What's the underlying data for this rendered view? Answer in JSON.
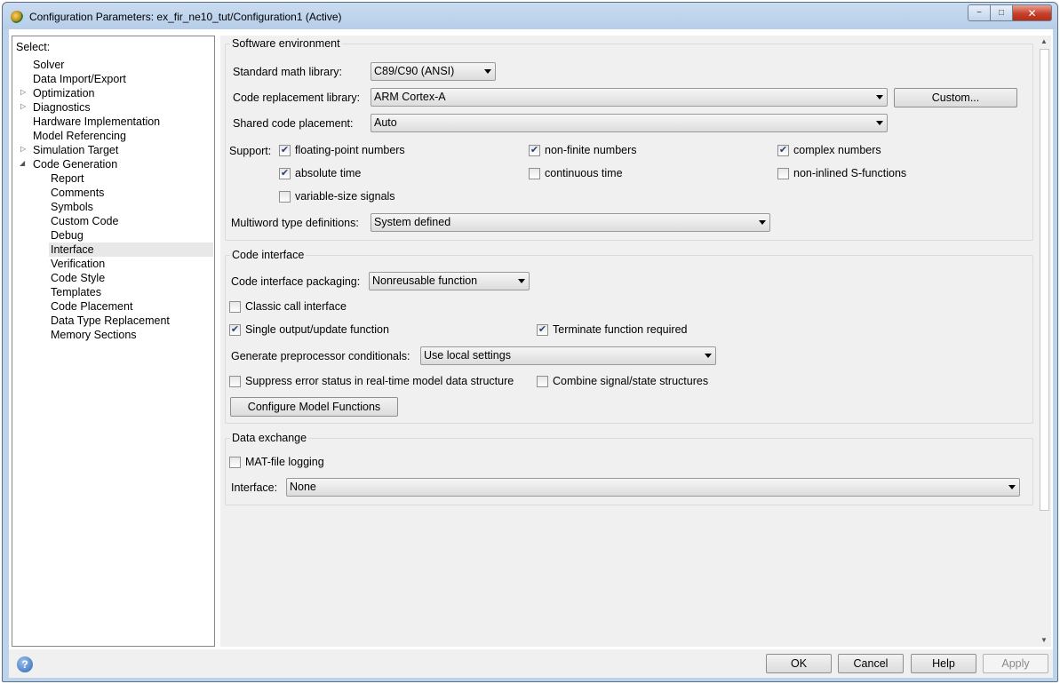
{
  "window": {
    "title": "Configuration Parameters: ex_fir_ne10_tut/Configuration1 (Active)",
    "controls": {
      "minimize": "−",
      "maximize": "□",
      "close": "✕"
    }
  },
  "tree": {
    "header": "Select:",
    "items": [
      {
        "label": "Solver"
      },
      {
        "label": "Data Import/Export"
      },
      {
        "label": "Optimization",
        "expander": "collapsed"
      },
      {
        "label": "Diagnostics",
        "expander": "collapsed"
      },
      {
        "label": "Hardware Implementation"
      },
      {
        "label": "Model Referencing"
      },
      {
        "label": "Simulation Target",
        "expander": "collapsed"
      },
      {
        "label": "Code Generation",
        "expander": "expanded"
      },
      {
        "label": "Report"
      },
      {
        "label": "Comments"
      },
      {
        "label": "Symbols"
      },
      {
        "label": "Custom Code"
      },
      {
        "label": "Debug"
      },
      {
        "label": "Interface",
        "selected": true
      },
      {
        "label": "Verification"
      },
      {
        "label": "Code Style"
      },
      {
        "label": "Templates"
      },
      {
        "label": "Code Placement"
      },
      {
        "label": "Data Type Replacement"
      },
      {
        "label": "Memory Sections"
      }
    ],
    "arrow_collapsed": "▷",
    "arrow_expanded": "◢"
  },
  "software_env": {
    "title": "Software environment",
    "math_lib_label": "Standard math library:",
    "math_lib_value": "C89/C90 (ANSI)",
    "crl_label": "Code replacement library:",
    "crl_value": "ARM Cortex-A",
    "custom_button": "Custom...",
    "shared_label": "Shared code placement:",
    "shared_value": "Auto",
    "support_label": "Support:",
    "support": {
      "floating_point": {
        "label": "floating-point numbers",
        "checked": true
      },
      "non_finite": {
        "label": "non-finite numbers",
        "checked": true
      },
      "complex": {
        "label": "complex numbers",
        "checked": true
      },
      "absolute_time": {
        "label": "absolute time",
        "checked": true
      },
      "continuous_time": {
        "label": "continuous time",
        "checked": false
      },
      "non_inlined": {
        "label": "non-inlined S-functions",
        "checked": false
      },
      "variable_size": {
        "label": "variable-size signals",
        "checked": false
      }
    },
    "multiword_label": "Multiword type definitions:",
    "multiword_value": "System defined"
  },
  "code_interface": {
    "title": "Code interface",
    "packaging_label": "Code interface packaging:",
    "packaging_value": "Nonreusable function",
    "classic_call": {
      "label": "Classic call interface",
      "checked": false
    },
    "single_output": {
      "label": "Single output/update function",
      "checked": true
    },
    "terminate_fn": {
      "label": "Terminate function required",
      "checked": true
    },
    "preproc_label": "Generate preprocessor conditionals:",
    "preproc_value": "Use local settings",
    "suppress_error": {
      "label": "Suppress error status in real-time model data structure",
      "checked": false
    },
    "combine_signal": {
      "label": "Combine signal/state structures",
      "checked": false
    },
    "configure_button": "Configure Model Functions"
  },
  "data_exchange": {
    "title": "Data exchange",
    "mat_logging": {
      "label": "MAT-file logging",
      "checked": false
    },
    "interface_label": "Interface:",
    "interface_value": "None"
  },
  "footer": {
    "help_icon": "?",
    "ok": "OK",
    "cancel": "Cancel",
    "help": "Help",
    "apply": "Apply"
  },
  "checkmark": "✔"
}
